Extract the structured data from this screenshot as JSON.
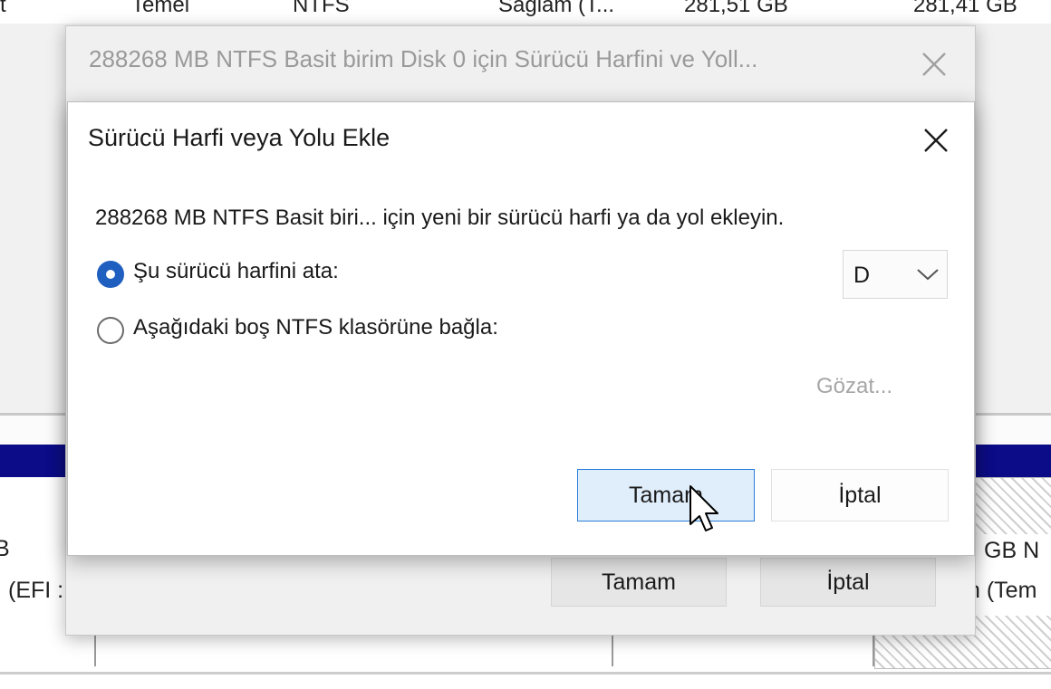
{
  "background": {
    "top_row": {
      "col1": "t",
      "col2": "Temel",
      "col3": "NTFS",
      "col4": "Sağlam (T...",
      "col5": "281,51 GB",
      "col6": "281,41 GB"
    },
    "left_fragment_1": "B",
    "left_fragment_2": "(EFI :",
    "right_fragment_1": "GB N",
    "right_fragment_2": "n (Tem"
  },
  "outer_dialog": {
    "title": "288268 MB NTFS Basit birim Disk 0 için Sürücü Harfini ve Yoll...",
    "ok_label": "Tamam",
    "cancel_label": "İptal"
  },
  "dialog": {
    "title": "Sürücü Harfi veya Yolu Ekle",
    "description": "288268 MB NTFS Basit biri... için yeni bir sürücü harfi ya da yol ekleyin.",
    "option_assign": {
      "label": "Şu sürücü harfini ata:",
      "selected": true
    },
    "option_mount": {
      "label": "Aşağıdaki boş NTFS klasörüne bağla:",
      "selected": false
    },
    "drive_letter": "D",
    "browse_label": "Gözat...",
    "ok_label": "Tamam",
    "cancel_label": "İptal"
  },
  "colors": {
    "accent": "#1f5fbf",
    "primary_button_bg": "#e0eefb",
    "primary_button_border": "#2a7ed8",
    "volume_bar": "#0c0c88"
  },
  "icons": {
    "close": "close-icon",
    "chevron": "chevron-down-icon",
    "cursor": "mouse-pointer-icon"
  }
}
